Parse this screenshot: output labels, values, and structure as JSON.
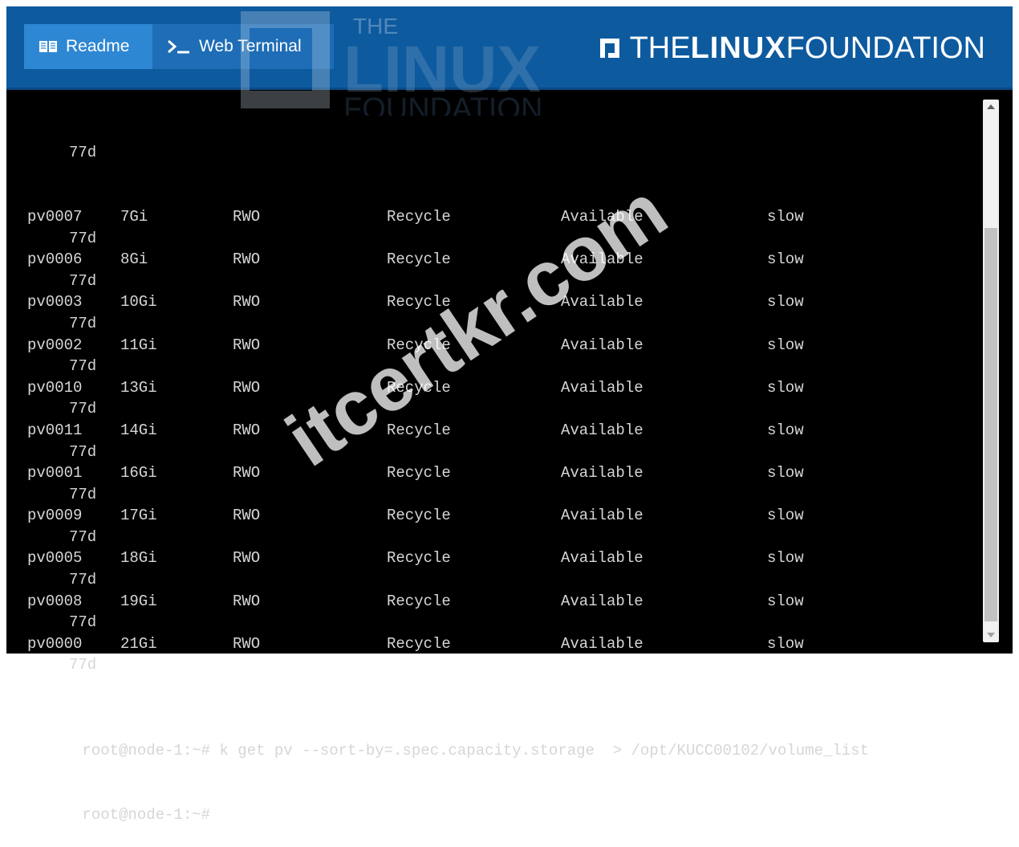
{
  "header": {
    "tabs": [
      {
        "label": "Readme",
        "icon": "book-icon"
      },
      {
        "label": "Web Terminal",
        "icon": "terminal-prompt-icon"
      }
    ],
    "brand": {
      "the": "THE",
      "linux": "LINUX",
      "foundation": "FOUNDATION"
    }
  },
  "watermarks": {
    "logo": {
      "top": "THE",
      "middle": "LINUX",
      "bottom": "FOUNDATION"
    },
    "site": "itcertkr.com"
  },
  "terminal": {
    "first_age": "77d",
    "rows": [
      {
        "name": "pv0007",
        "capacity": "7Gi",
        "access": "RWO",
        "policy": "Recycle",
        "status": "Available",
        "storage_class": "slow",
        "age": "77d"
      },
      {
        "name": "pv0006",
        "capacity": "8Gi",
        "access": "RWO",
        "policy": "Recycle",
        "status": "Available",
        "storage_class": "slow",
        "age": "77d"
      },
      {
        "name": "pv0003",
        "capacity": "10Gi",
        "access": "RWO",
        "policy": "Recycle",
        "status": "Available",
        "storage_class": "slow",
        "age": "77d"
      },
      {
        "name": "pv0002",
        "capacity": "11Gi",
        "access": "RWO",
        "policy": "Recycle",
        "status": "Available",
        "storage_class": "slow",
        "age": "77d"
      },
      {
        "name": "pv0010",
        "capacity": "13Gi",
        "access": "RWO",
        "policy": "Recycle",
        "status": "Available",
        "storage_class": "slow",
        "age": "77d"
      },
      {
        "name": "pv0011",
        "capacity": "14Gi",
        "access": "RWO",
        "policy": "Recycle",
        "status": "Available",
        "storage_class": "slow",
        "age": "77d"
      },
      {
        "name": "pv0001",
        "capacity": "16Gi",
        "access": "RWO",
        "policy": "Recycle",
        "status": "Available",
        "storage_class": "slow",
        "age": "77d"
      },
      {
        "name": "pv0009",
        "capacity": "17Gi",
        "access": "RWO",
        "policy": "Recycle",
        "status": "Available",
        "storage_class": "slow",
        "age": "77d"
      },
      {
        "name": "pv0005",
        "capacity": "18Gi",
        "access": "RWO",
        "policy": "Recycle",
        "status": "Available",
        "storage_class": "slow",
        "age": "77d"
      },
      {
        "name": "pv0008",
        "capacity": "19Gi",
        "access": "RWO",
        "policy": "Recycle",
        "status": "Available",
        "storage_class": "slow",
        "age": "77d"
      },
      {
        "name": "pv0000",
        "capacity": "21Gi",
        "access": "RWO",
        "policy": "Recycle",
        "status": "Available",
        "storage_class": "slow",
        "age": "77d"
      }
    ],
    "command_line": "root@node-1:~# k get pv --sort-by=.spec.capacity.storage  > /opt/KUCC00102/volume_list",
    "prompt": "root@node-1:~#"
  },
  "colors": {
    "header_bg": "#0e5a9f",
    "tab_active": "#2e87d3",
    "tab_inactive": "#1e6db6",
    "terminal_bg": "#000000",
    "terminal_text": "#d6d6d6"
  }
}
